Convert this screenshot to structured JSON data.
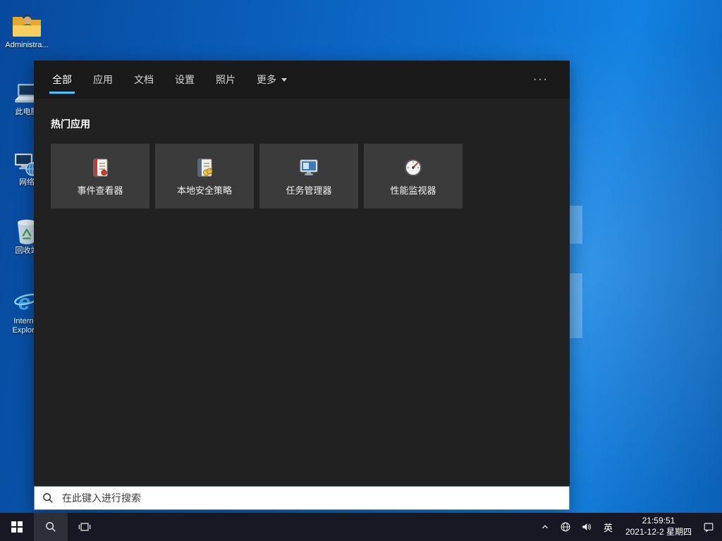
{
  "desktop": {
    "icons": [
      {
        "label": "Administra..."
      },
      {
        "label": "此电脑"
      },
      {
        "label": "网络"
      },
      {
        "label": "回收站"
      },
      {
        "label": "Internet Explorer"
      }
    ]
  },
  "search_panel": {
    "tabs": [
      {
        "label": "全部"
      },
      {
        "label": "应用"
      },
      {
        "label": "文档"
      },
      {
        "label": "设置"
      },
      {
        "label": "照片"
      },
      {
        "label": "更多"
      }
    ],
    "more_options_icon": "···",
    "section_title": "热门应用",
    "tiles": [
      {
        "label": "事件查看器"
      },
      {
        "label": "本地安全策略"
      },
      {
        "label": "任务管理器"
      },
      {
        "label": "性能监视器"
      }
    ],
    "search_input_placeholder": "在此键入进行搜索"
  },
  "taskbar": {
    "ime_indicator": "英",
    "clock": {
      "time": "21:59:51",
      "date": "2021-12-2 星期四"
    }
  },
  "colors": {
    "accent": "#0078d7",
    "tab_underline": "#4cc2ff",
    "desktop_blue": "#0f6fce",
    "panel_bg": "#212121",
    "tabs_bg": "#1a1a1a",
    "tile_bg": "#3b3b3b",
    "taskbar_bg": "#181824"
  }
}
